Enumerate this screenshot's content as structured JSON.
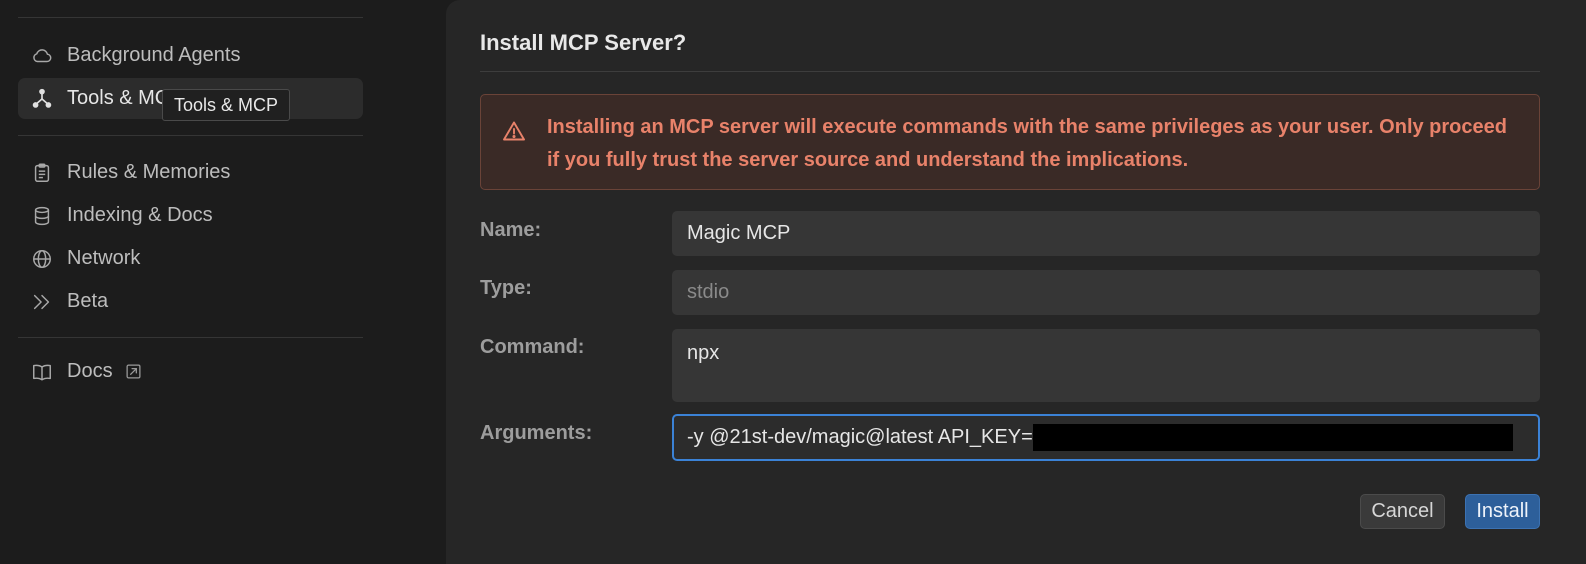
{
  "sidebar": {
    "items": [
      {
        "label": "Background Agents",
        "icon": "cloud-icon"
      },
      {
        "label": "Tools & MCP",
        "icon": "tools-network-icon",
        "active": true
      },
      {
        "label": "Rules & Memories",
        "icon": "clipboard-icon"
      },
      {
        "label": "Indexing & Docs",
        "icon": "database-icon"
      },
      {
        "label": "Network",
        "icon": "globe-icon"
      },
      {
        "label": "Beta",
        "icon": "double-chevron-icon"
      },
      {
        "label": "Docs",
        "icon": "book-icon",
        "external": true
      }
    ],
    "tooltip": "Tools & MCP"
  },
  "dialog": {
    "title": "Install MCP Server?",
    "warning": "Installing an MCP server will execute commands with the same privileges as your user. Only proceed if you fully trust the server source and understand the implications.",
    "fields": {
      "name_label": "Name:",
      "name_value": "Magic MCP",
      "type_label": "Type:",
      "type_value": "stdio",
      "command_label": "Command:",
      "command_value": "npx",
      "arguments_label": "Arguments:",
      "arguments_value": "-y @21st-dev/magic@latest API_KEY="
    },
    "buttons": {
      "cancel": "Cancel",
      "install": "Install"
    }
  },
  "colors": {
    "accent": "#3b82d6",
    "warning_text": "#e8826a",
    "install_button": "#2d5f9a"
  }
}
